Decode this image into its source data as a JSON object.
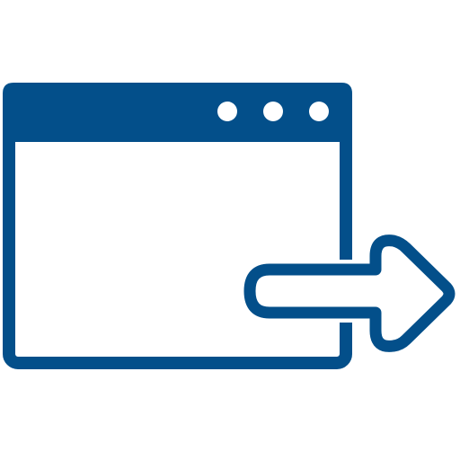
{
  "icon": {
    "name": "window-export-icon",
    "parts": [
      "browser-window",
      "title-bar",
      "window-control-dots",
      "exit-arrow"
    ],
    "window_control_count": 3
  },
  "colors": {
    "stroke": "#034f8a",
    "fill": "#034f8a",
    "background": "#ffffff",
    "inner": "#ffffff"
  }
}
